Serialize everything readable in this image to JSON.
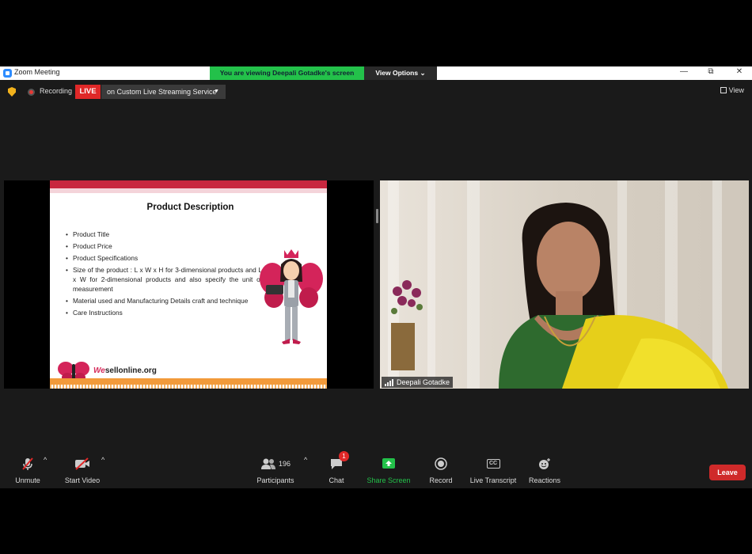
{
  "window": {
    "app_title": "Zoom Meeting",
    "banner_message": "You are viewing Deepali Gotadke's screen",
    "view_options_label": "View Options ⌄",
    "minimize": "—",
    "restore": "⧉",
    "close": "✕"
  },
  "topbar": {
    "recording_label": "Recording",
    "live_label": "LIVE",
    "stream_service": "on Custom Live Streaming Service",
    "view_label": "View"
  },
  "slide": {
    "title": "Product Description",
    "bullets": [
      "Product Title",
      "Product Price",
      "Product Specifications",
      "Size of the product : L x W x H for 3-dimensional products and L x W for 2-dimensional products and also specify the unit of measurement",
      "Material used and Manufacturing Details craft and technique",
      "Care Instructions"
    ],
    "footer_prefix": "We",
    "footer_suffix": "sellonline.org"
  },
  "video": {
    "participant_name": "Deepali Gotadke"
  },
  "toolbar": {
    "unmute": "Unmute",
    "start_video": "Start Video",
    "participants": "Participants",
    "participants_count": "196",
    "chat": "Chat",
    "chat_badge": "1",
    "share_screen": "Share Screen",
    "record": "Record",
    "live_transcript": "Live Transcript",
    "live_transcript_icon": "CC",
    "reactions": "Reactions",
    "leave": "Leave"
  },
  "colors": {
    "accent_green": "#23c14a",
    "live_red": "#e02828",
    "leave_red": "#cf2a2a"
  }
}
